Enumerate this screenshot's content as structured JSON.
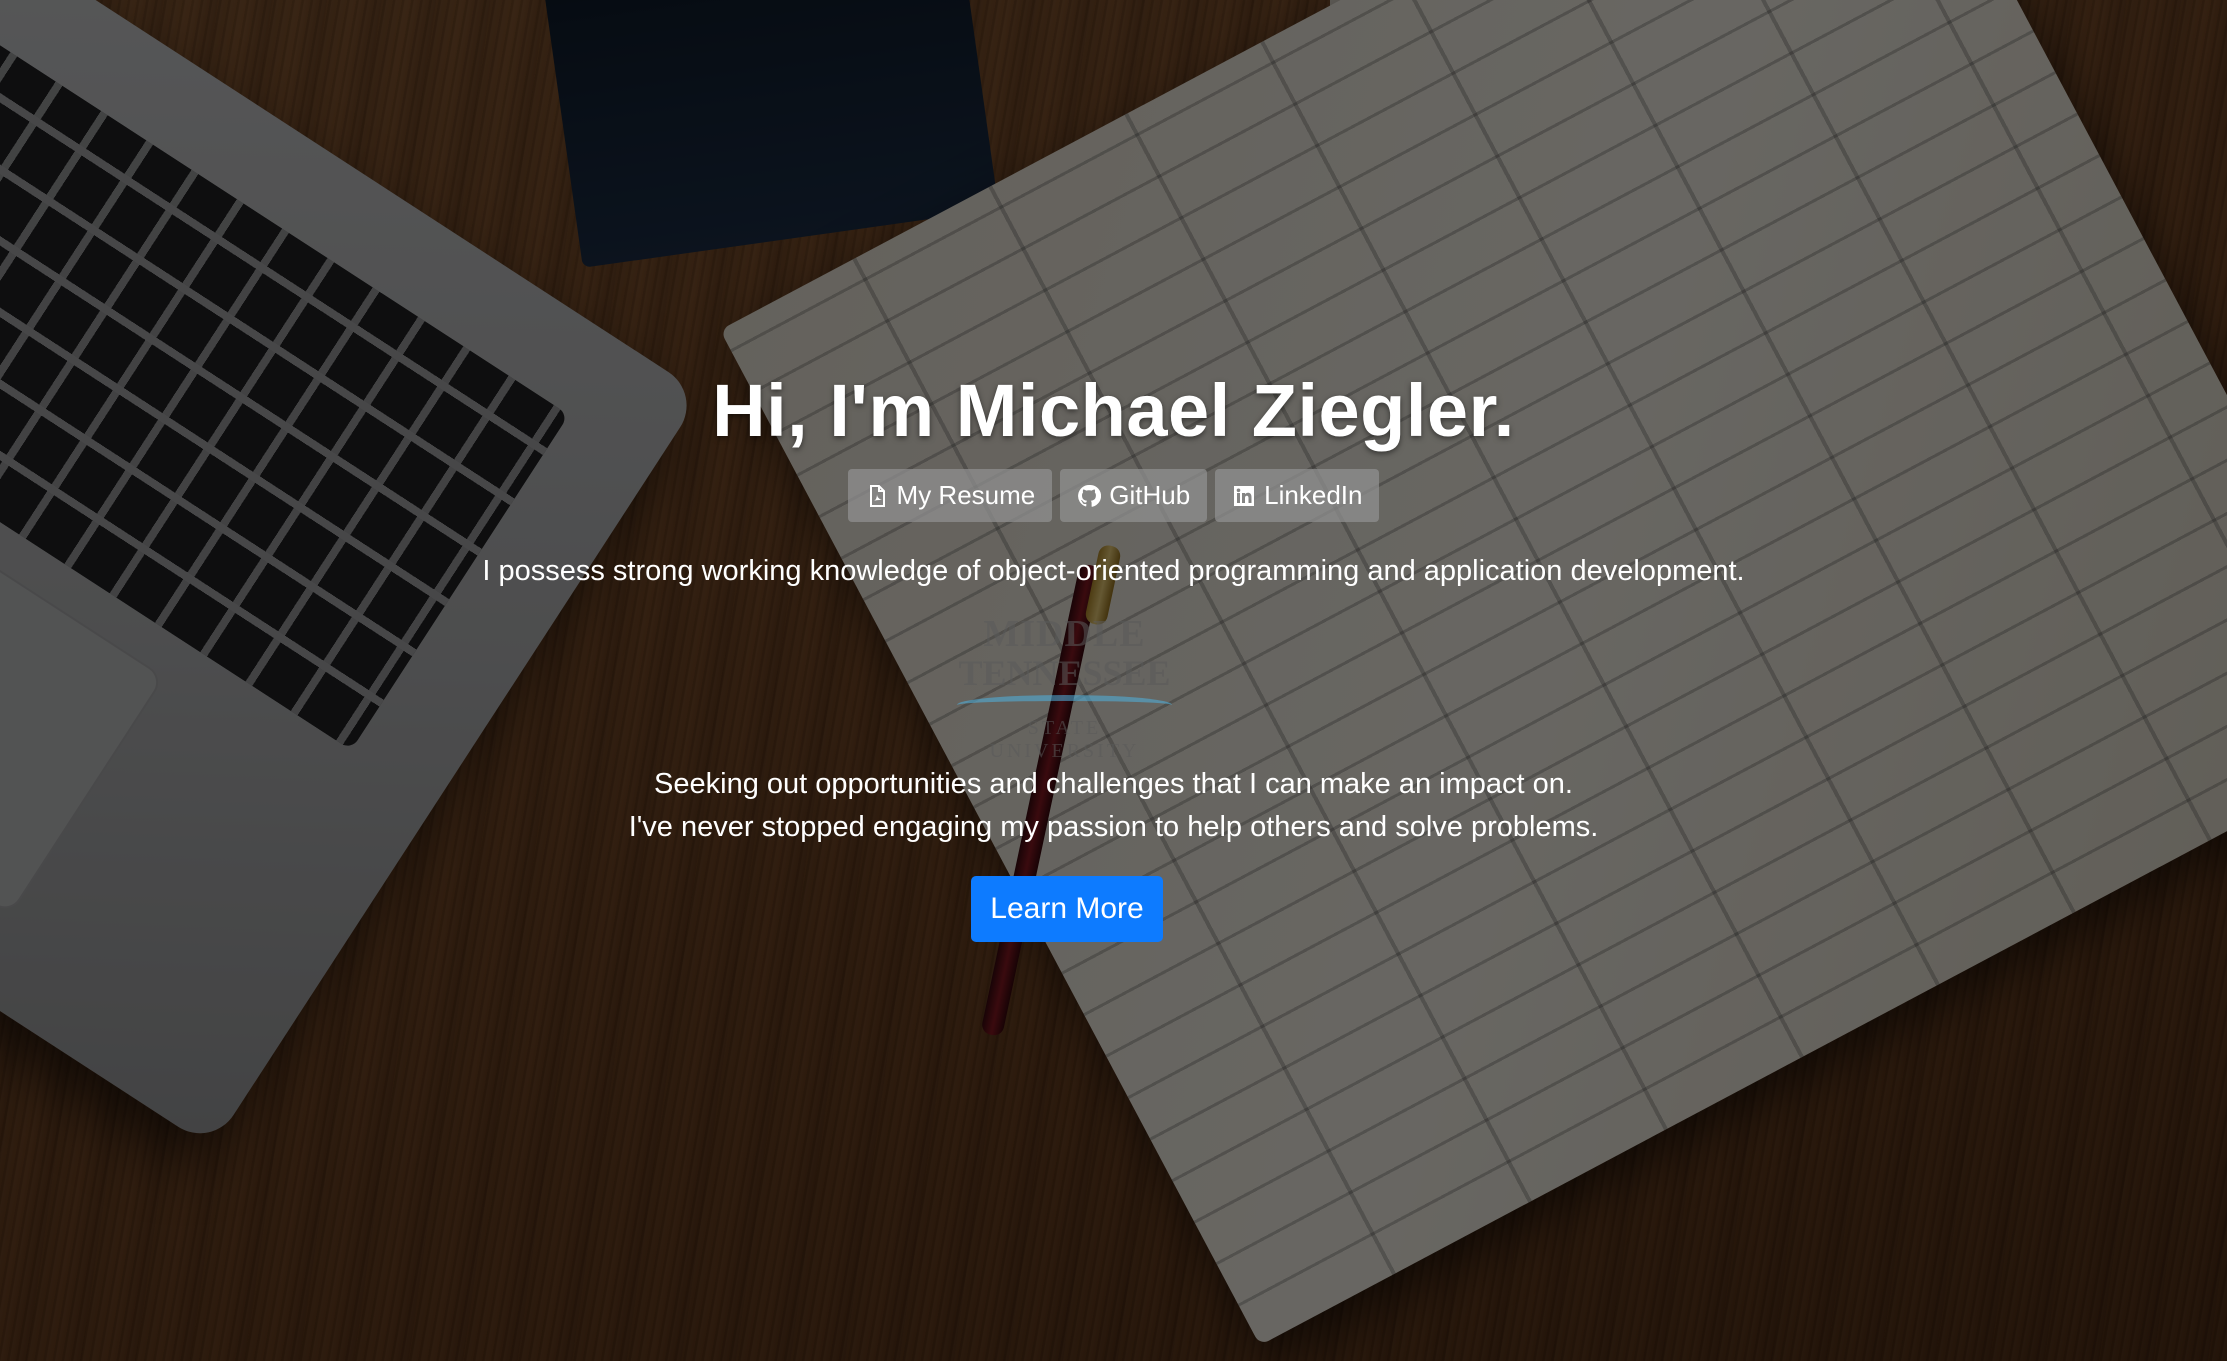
{
  "hero": {
    "title": "Hi, I'm Michael Ziegler.",
    "links": [
      {
        "label": "My Resume",
        "icon": "pdf-file-icon"
      },
      {
        "label": "GitHub",
        "icon": "github-icon"
      },
      {
        "label": "LinkedIn",
        "icon": "linkedin-icon"
      }
    ],
    "tagline": "I possess strong working knowledge of object-oriented programming and application development.",
    "logo": {
      "line1": "MIDDLE",
      "line2": "TENNESSEE",
      "line3": "STATE UNIVERSITY",
      "accent_color": "#4fb3e0"
    },
    "mission_lines": [
      "Seeking out opportunities and challenges that I can make an impact on.",
      "I've never stopped engaging my passion to help others and solve problems."
    ],
    "cta_label": "Learn More"
  },
  "colors": {
    "cta": "#0d7bff",
    "link_button": "#919191",
    "text": "#ffffff"
  }
}
